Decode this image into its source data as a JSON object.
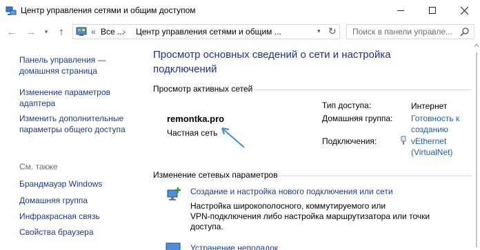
{
  "window": {
    "title": "Центр управления сетями и общим доступом"
  },
  "address": {
    "overflow": "«",
    "crumb_all": "Все ...",
    "separator": "›",
    "crumb_current": "Центр управления сетями и общим ...",
    "search_placeholder": "Поиск в панели управле..."
  },
  "sidebar": {
    "links": [
      {
        "line1": "Панель управления —",
        "line2": "домашняя страница"
      },
      {
        "line1": "Изменение параметров",
        "line2": "адаптера"
      },
      {
        "line1": "Изменить дополнительные",
        "line2": "параметры общего доступа"
      }
    ],
    "see_also_label": "См. также",
    "see_also": [
      "Брандмауэр Windows",
      "Домашняя группа",
      "Инфракрасная связь",
      "Свойства браузера"
    ]
  },
  "main": {
    "title_line1": "Просмотр основных сведений о сети и настройка",
    "title_line2": "подключений",
    "active_networks_header": "Просмотр активных сетей",
    "network": {
      "name": "remontka.pro",
      "type": "Частная сеть"
    },
    "properties": {
      "access_label": "Тип доступа:",
      "access_value": "Интернет",
      "homegroup_label": "Домашняя группа:",
      "homegroup_line1": "Готовность к",
      "homegroup_line2": "созданию",
      "connections_label": "Подключения:",
      "connection_line1": "vEthernet",
      "connection_line2": "(VirtualNet)"
    },
    "change_header": "Изменение сетевых параметров",
    "tasks": [
      {
        "link": "Создание и настройка нового подключения или сети",
        "desc_line1": "Настройка широкополосного, коммутируемого или",
        "desc_line2": "VPN-подключения либо настройка маршрутизатора или точки",
        "desc_line3": "доступа."
      },
      {
        "link": "Устранение неполадок"
      }
    ]
  },
  "colors": {
    "link": "#1a3d8f",
    "title": "#1e3287",
    "value_link": "#1a5fb4",
    "annotation_arrow": "#3a8fd0"
  }
}
